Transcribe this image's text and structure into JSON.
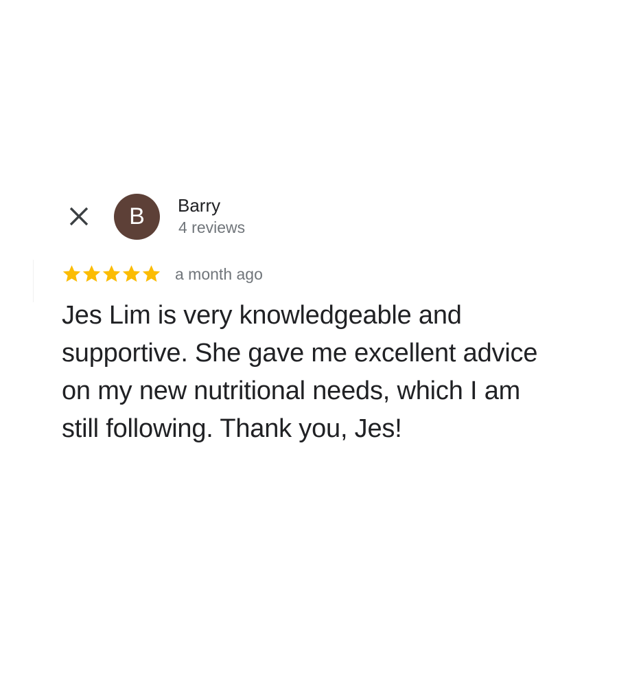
{
  "review": {
    "author": {
      "initial": "B",
      "name": "Barry",
      "reviews_count": "4 reviews",
      "avatar_color": "#5d4037"
    },
    "rating": {
      "stars": 5,
      "max": 5,
      "star_color": "#fbbc04"
    },
    "time": "a month ago",
    "text": "Jes Lim is very knowledgeable and supportive. She gave me excellent advice on my new nutritional needs, which I am still following. Thank you, Jes!"
  },
  "icons": {
    "close": "close-icon",
    "star": "star-icon"
  }
}
